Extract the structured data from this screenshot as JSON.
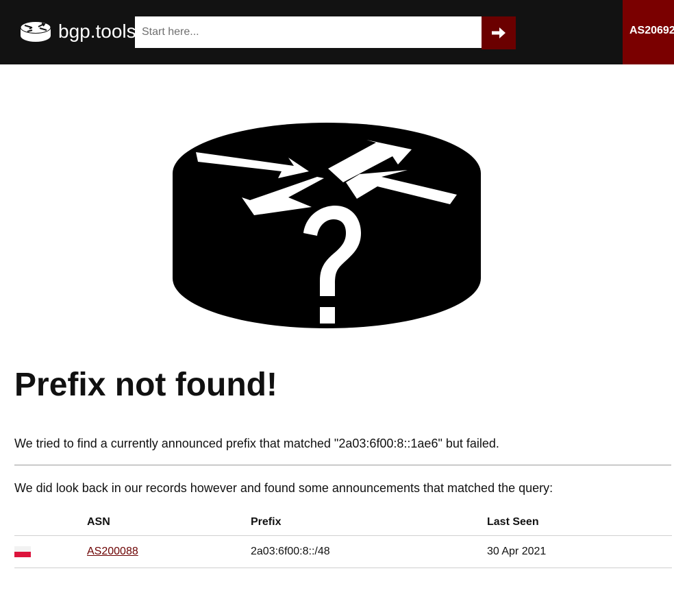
{
  "header": {
    "brand": "bgp.tools",
    "search_placeholder": "Start here...",
    "search_value": "",
    "asn_badge": "AS20692",
    "colors": {
      "bar": "#121212",
      "accent": "#7a0000"
    }
  },
  "illustration": {
    "icon": "router-question-icon"
  },
  "main": {
    "title": "Prefix not found!",
    "message": "We tried to find a currently announced prefix that matched \"2a03:6f00:8::1ae6\" but failed.",
    "history_message": "We did look back in our records however and found some announcements that matched the query:",
    "table": {
      "headers": [
        "",
        "ASN",
        "Prefix",
        "Last Seen"
      ],
      "rows": [
        {
          "flag_icon": "poland-flag-icon",
          "asn": "AS200088",
          "prefix": "2a03:6f00:8::/48",
          "last_seen": "30 Apr 2021"
        }
      ]
    }
  }
}
